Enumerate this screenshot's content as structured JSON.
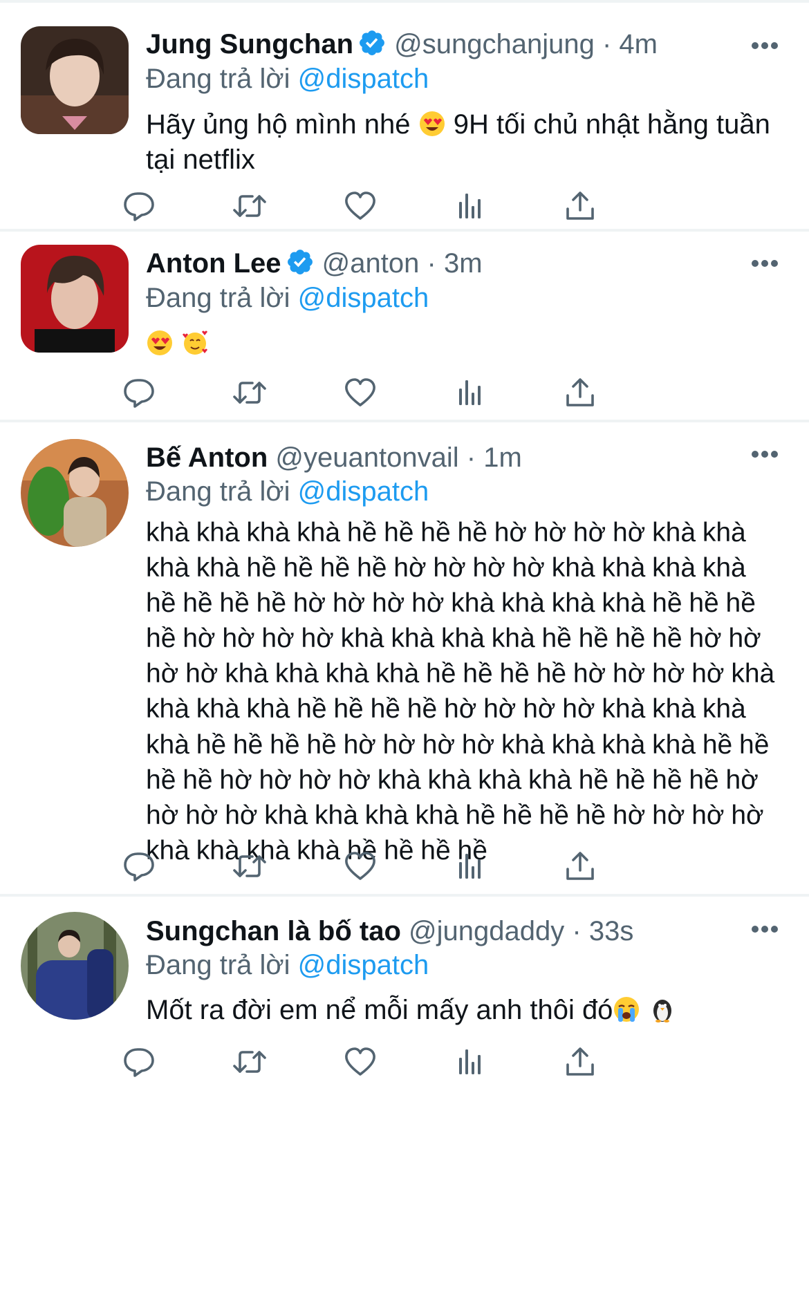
{
  "colors": {
    "link": "#1d9bf0",
    "muted": "#536471",
    "text": "#0f1419",
    "divider": "#eff3f4"
  },
  "reply_prefix": "Đang trả lời",
  "tweets": [
    {
      "name": "Jung Sungchan",
      "verified": true,
      "handle": "@sungchanjung",
      "time": "4m",
      "reply_to": "@dispatch",
      "text": "Hãy ủng hộ mình nhé",
      "text_after_emoji": " 9H tối chủ nhật hằng tuần tại netflix",
      "emojis": [
        "heart-eyes-emoji"
      ]
    },
    {
      "name": "Anton Lee",
      "verified": true,
      "handle": "@anton",
      "time": "3m",
      "reply_to": "@dispatch",
      "emojis": [
        "heart-eyes-emoji",
        "smiling-hearts-emoji"
      ]
    },
    {
      "name": "Bế Anton",
      "verified": false,
      "handle": "@yeuantonvail",
      "time": "1m",
      "reply_to": "@dispatch",
      "text": "khà khà khà khà hề hề hề hề hờ hờ hờ hờ khà khà khà khà hề hề hề hề hờ hờ hờ hờ khà khà khà khà hề hề hề hề hờ hờ hờ hờ khà khà khà khà hề hề hề hề hờ hờ hờ hờ khà khà khà khà hề hề hề hề hờ hờ hờ hờ khà khà khà khà hề hề hề hề hờ hờ hờ hờ khà khà khà khà hề hề hề hề hờ hờ hờ hờ khà khà khà khà hề hề hề hề hờ hờ hờ hờ khà khà khà khà hề hề hề hề hờ hờ hờ hờ khà khà khà khà hề hề hề hề hờ hờ hờ hờ khà khà khà khà hề hề hề hề hờ hờ hờ hờ khà khà khà khà hề hề hề hề"
    },
    {
      "name": "Sungchan là bố tao",
      "verified": false,
      "handle": "@jungdaddy",
      "time": "33s",
      "reply_to": "@dispatch",
      "text": "Mốt ra đời em nể mỗi mấy anh thôi đó",
      "emojis": [
        "crying-emoji",
        "penguin-emoji"
      ]
    }
  ],
  "actions": [
    "reply-icon",
    "retweet-icon",
    "like-icon",
    "views-icon",
    "share-icon"
  ]
}
